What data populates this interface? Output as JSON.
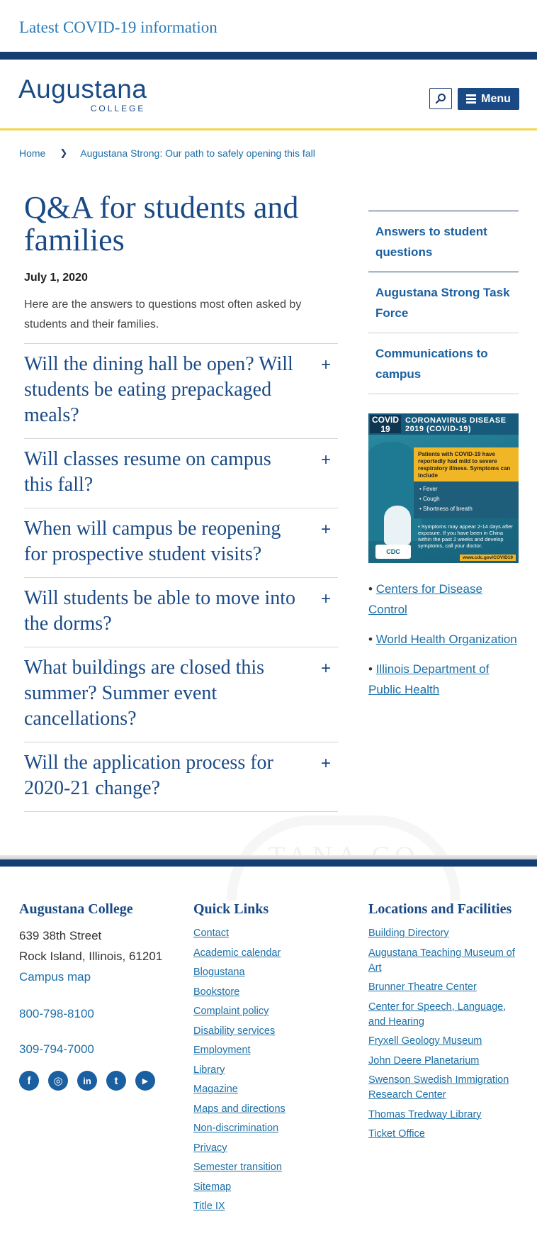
{
  "covid_banner": {
    "text": "Latest COVID-19 information"
  },
  "header": {
    "logo_main": "Augustana",
    "logo_sub": "COLLEGE",
    "menu_label": "Menu"
  },
  "breadcrumb": {
    "home": "Home",
    "current": "Augustana Strong: Our path to safely opening this fall"
  },
  "main": {
    "title": "Q&A for students and families",
    "date": "July 1, 2020",
    "intro": "Here are the answers to questions most often asked by students and their families.",
    "faq": [
      "Will the dining hall be open? Will students be eating prepackaged meals?",
      "Will classes resume on campus this fall?",
      "When will campus be reopening for prospective student visits?",
      "Will students be able to move into the dorms?",
      "What buildings are closed this summer? Summer event cancellations?",
      "Will the application process for 2020-21 change?"
    ],
    "expand_symbol": "+"
  },
  "sidebar": {
    "nav": [
      "Answers to student questions",
      "Augustana Strong Task Force",
      "Communications to campus"
    ],
    "poster": {
      "badge_line1": "COVID",
      "badge_line2": "19",
      "title_line1": "CORONAVIRUS DISEASE",
      "title_line2": "2019 (COVID-19)",
      "intro": "Patients with COVID-19 have reportedly had mild to severe respiratory illness. Symptoms can include",
      "symptoms": [
        "• Fever",
        "• Cough",
        "• Shortness of breath"
      ],
      "note": "• Symptoms may appear 2-14 days after exposure. If you have been in China within the past 2 weeks and develop symptoms, call your doctor.",
      "url": "www.cdc.gov/COVID19",
      "logo": "CDC"
    },
    "resources": [
      "Centers for Disease Control",
      "World Health Organization",
      "Illinois Department of Public Health"
    ],
    "bullet": "•"
  },
  "watermark": "TANA CO",
  "footer": {
    "college": {
      "heading": "Augustana College",
      "street": "639 38th Street",
      "city": "Rock Island, Illinois, 61201",
      "map_link": "Campus map",
      "phone1": "800-798-8100",
      "phone2": "309-794-7000"
    },
    "social": [
      {
        "icon": "facebook-icon",
        "glyph": "f"
      },
      {
        "icon": "instagram-icon",
        "glyph": "◎"
      },
      {
        "icon": "linkedin-icon",
        "glyph": "in"
      },
      {
        "icon": "twitter-icon",
        "glyph": "t"
      },
      {
        "icon": "youtube-icon",
        "glyph": "▶"
      }
    ],
    "quick_links": {
      "heading": "Quick Links",
      "items": [
        "Contact",
        "Academic calendar",
        "Blogustana",
        "Bookstore",
        "Complaint policy",
        "Disability services",
        "Employment",
        "Library",
        "Magazine",
        "Maps and directions",
        "Non-discrimination",
        "Privacy",
        "Semester transition",
        "Sitemap",
        "Title IX"
      ]
    },
    "locations": {
      "heading": "Locations and Facilities",
      "items": [
        "Building Directory",
        "Augustana Teaching Museum of Art",
        "Brunner Theatre Center",
        "Center for Speech, Language, and Hearing",
        "Fryxell Geology Museum",
        "John Deere Planetarium",
        "Swenson Swedish Immigration Research Center",
        "Thomas Tredway Library",
        "Ticket Office"
      ]
    }
  },
  "colors": {
    "navy": "#153f73",
    "brand_blue": "#1a4a86",
    "link_blue": "#1c6fa8",
    "gold": "#f2d84b"
  }
}
